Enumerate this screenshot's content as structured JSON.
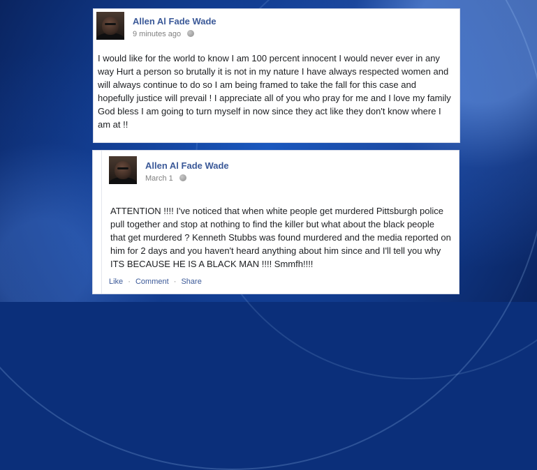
{
  "posts": [
    {
      "author": "Allen Al Fade Wade",
      "time": "9 minutes ago",
      "text": "I would like for the world to know I am 100 percent innocent I would never ever in any way Hurt a person so brutally it is not in my nature I have always respected women and will always continue to do so I am being framed to take the fall for this case and hopefully justice will prevail ! I appreciate all of you who pray for me and I love my family God bless I am going to turn myself in now since they act like they don't know where I am at !!"
    },
    {
      "author": "Allen Al Fade Wade",
      "time": "March 1",
      "text": "ATTENTION !!!! I've noticed that when white people get murdered Pittsburgh police pull together and stop at nothing to find the killer but what about the black people that get murdered ? Kenneth Stubbs was found murdered and the media reported on him for 2 days and you haven't heard anything about him since and I'll tell you why ITS BECAUSE HE IS A BLACK MAN !!!! Smmfh!!!!"
    }
  ],
  "actions": {
    "like": "Like",
    "comment": "Comment",
    "share": "Share",
    "separator": "·"
  },
  "icons": {
    "privacy": "globe-icon",
    "avatar": "profile-photo"
  },
  "colors": {
    "link": "#3b5998",
    "meta": "#7f7f7f",
    "background": "#123f95"
  }
}
